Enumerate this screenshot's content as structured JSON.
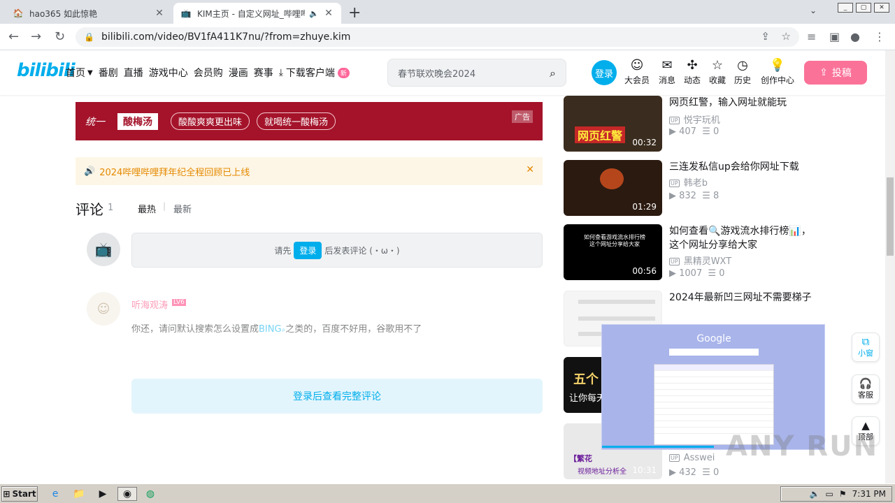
{
  "browser": {
    "tabs": [
      {
        "title": "hao365 如此惊艳",
        "active": false
      },
      {
        "title": "KIM主页 - 自定义网址_哔哩哔哩",
        "active": true
      }
    ],
    "new_tab_glyph": "+",
    "url": "bilibili.com/video/BV1fA411K7nu/?from=zhuye.kim"
  },
  "header": {
    "logo": "bilibili",
    "nav": [
      {
        "label": "首页",
        "dropdown": true
      },
      {
        "label": "番剧"
      },
      {
        "label": "直播"
      },
      {
        "label": "游戏中心"
      },
      {
        "label": "会员购"
      },
      {
        "label": "漫画"
      },
      {
        "label": "赛事"
      },
      {
        "label": "下载客户端",
        "badge": "新"
      }
    ],
    "search_placeholder": "春节联欢晚会2024",
    "login": "登录",
    "icons": [
      {
        "label": "大会员",
        "icon": "vip-icon"
      },
      {
        "label": "消息",
        "icon": "message-icon"
      },
      {
        "label": "动态",
        "icon": "dynamic-icon"
      },
      {
        "label": "收藏",
        "icon": "favorite-icon"
      },
      {
        "label": "历史",
        "icon": "history-icon"
      },
      {
        "label": "创作中心",
        "icon": "creator-icon"
      }
    ],
    "upload": "投稿"
  },
  "main": {
    "ad": {
      "brand": "统一",
      "product": "酸梅汤",
      "slogan1": "酸酸爽爽更出味",
      "slogan2": "就喝统一酸梅汤",
      "tag": "广告"
    },
    "notice": "2024哔哩哔哩拜年纪全程回顾已上线",
    "comments": {
      "title": "评论",
      "count": "1",
      "sort_hot": "最热",
      "sort_new": "最新",
      "prompt_before": "请先",
      "prompt_login": "登录",
      "prompt_after": "后发表评论 (・ω・)",
      "first": {
        "user": "听海观涛",
        "level": "LV6",
        "text_before": "你还，请问默认搜索怎么设置成",
        "text_link": "BING",
        "text_after": "之类的，百度不好用，谷歌用不了"
      },
      "view_all": "登录后查看完整评论"
    }
  },
  "recommend": [
    {
      "title": "网页红警，输入网址就能玩",
      "up": "悦宇玩机",
      "views": "407",
      "danmaku": "0",
      "duration": "00:32",
      "thumb": "#3a2c1e"
    },
    {
      "title": "三连发私信up会给你网址下载",
      "up": "韩老b",
      "views": "832",
      "danmaku": "8",
      "duration": "01:29",
      "thumb": "#2b1a10"
    },
    {
      "title": "如何查看🔍游戏流水排行榜📊，这个网址分享给大家",
      "up": "黑精灵WXT",
      "views": "1007",
      "danmaku": "0",
      "duration": "00:56",
      "thumb": "#000000"
    },
    {
      "title": "2024年最新凹三网址不需要梯子",
      "up": "",
      "views": "",
      "danmaku": "",
      "duration": "",
      "thumb": "#f5f5f5"
    },
    {
      "title": "",
      "up": "",
      "views": "",
      "danmaku": "",
      "duration": "",
      "thumb": "#111111"
    },
    {
      "title": "",
      "up": "Asswei",
      "views": "432",
      "danmaku": "0",
      "duration": "10:31",
      "thumb": "#e9e9e9"
    }
  ],
  "side_buttons": [
    {
      "label": "小窗",
      "icon": "mini-window-icon"
    },
    {
      "label": "客服",
      "icon": "headset-icon"
    },
    {
      "label": "顶部",
      "icon": "arrow-up-icon"
    }
  ],
  "mini_player": {
    "logo_text": "Google"
  },
  "watermark": "ANY RUN",
  "taskbar": {
    "start": "Start",
    "clock": "7:31 PM"
  }
}
